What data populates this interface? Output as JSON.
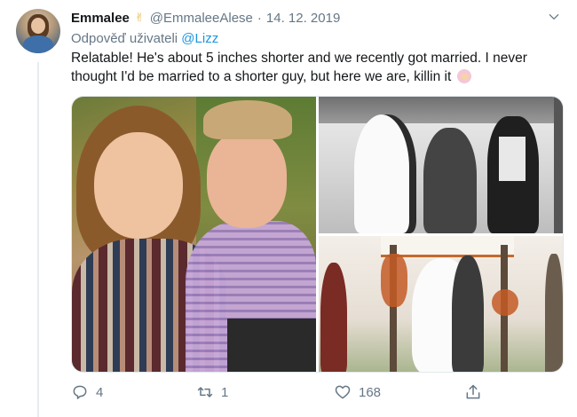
{
  "tweet": {
    "author_name": "Emmalee",
    "author_emoji": "✌",
    "handle": "@EmmaleeAlese",
    "separator": "·",
    "date": "14. 12. 2019",
    "reply_prefix": "Odpověď uživateli",
    "reply_to": "@Lizz",
    "text": "Relatable! He's about 5 inches shorter and we recently got married. I never thought I'd be married to a shorter guy, but here we are, killin it",
    "trailing_emoji": "facepalm-emoji"
  },
  "actions": {
    "replies": "4",
    "retweets": "1",
    "likes": "168"
  },
  "icons": {
    "menu": "chevron-down-icon",
    "reply": "reply-icon",
    "retweet": "retweet-icon",
    "like": "heart-icon",
    "share": "share-icon"
  },
  "colors": {
    "text": "#14171a",
    "secondary": "#657786",
    "link": "#1b95e0",
    "divider": "#e6ecf0"
  }
}
